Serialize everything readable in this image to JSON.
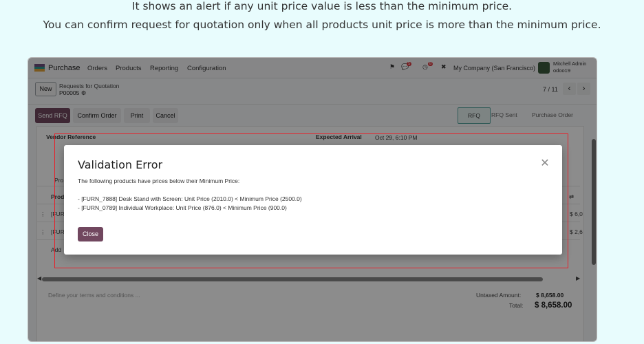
{
  "caption": {
    "line1": "It shows an alert if any unit price value is less than the minimum price.",
    "line2": "You can confirm request for quotation only when all products unit price is more than the minimum price."
  },
  "navbar": {
    "brand": "Purchase",
    "menu": [
      "Orders",
      "Products",
      "Reporting",
      "Configuration"
    ],
    "messages_badge": "5",
    "activity_badge": "8",
    "company": "My Company (San Francisco)",
    "user_name": "Mitchell Admin",
    "user_db": "odoo19"
  },
  "breadcrumb": {
    "new_label": "New",
    "parent": "Requests for Quotation",
    "record": "P00005"
  },
  "pager": {
    "text": "7 / 11",
    "prev": "‹",
    "next": "›"
  },
  "actions": {
    "send_rfq": "Send RFQ",
    "confirm_order": "Confirm Order",
    "print": "Print",
    "cancel": "Cancel"
  },
  "statusbar": {
    "stages": [
      "RFQ",
      "RFQ Sent",
      "Purchase Order"
    ],
    "active": "RFQ"
  },
  "form": {
    "vendor_ref_label": "Vendor Reference",
    "expected_arrival_label": "Expected Arrival",
    "expected_arrival_value": "Oct 29, 6:10 PM",
    "tab_partial": "Pro",
    "col_partial": "Prod",
    "row1_partial": "[FUR",
    "row2_partial": "[FUR",
    "row1_amount": "$ 6,0",
    "row2_amount": "$ 2,6",
    "add_partial": "Add",
    "terms_placeholder": "Define your terms and conditions ...",
    "untaxed_label": "Untaxed Amount:",
    "untaxed_value": "$ 8,658.00",
    "total_label": "Total:",
    "total_value": "$ 8,658.00"
  },
  "dialog": {
    "title": "Validation Error",
    "message": "The following products have prices below their Minimum Price:",
    "lines": [
      "- [FURN_7888] Desk Stand with Screen: Unit Price (2010.0) < Minimum Price (2500.0)",
      "- [FURN_0789] Individual Workplace: Unit Price (876.0) < Minimum Price (900.0)"
    ],
    "close_label": "Close"
  },
  "colors": {
    "primary": "#71475f",
    "highlight": "#e8202a",
    "page_bg": "#e8fcfd"
  }
}
